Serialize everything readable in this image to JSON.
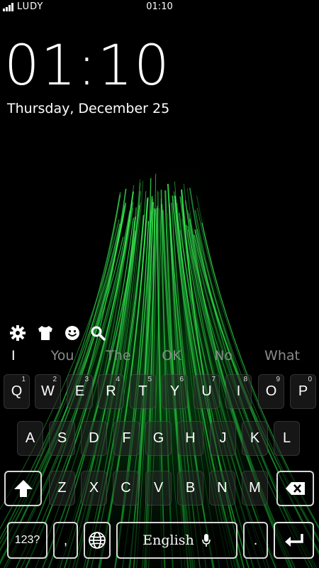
{
  "status_bar": {
    "carrier": "LUDY",
    "time": "01:10"
  },
  "lockscreen": {
    "clock": "01:10",
    "date": "Thursday, December 25"
  },
  "toolbar": {
    "icons": [
      "gear-icon",
      "shirt-icon",
      "smiley-icon",
      "search-icon"
    ]
  },
  "suggestions": [
    "I",
    "You",
    "The",
    "OK",
    "No",
    "What"
  ],
  "keyboard": {
    "row1": [
      {
        "k": "Q",
        "h": "1"
      },
      {
        "k": "W",
        "h": "2"
      },
      {
        "k": "E",
        "h": "3"
      },
      {
        "k": "R",
        "h": "4"
      },
      {
        "k": "T",
        "h": "5"
      },
      {
        "k": "Y",
        "h": "6"
      },
      {
        "k": "U",
        "h": "7"
      },
      {
        "k": "I",
        "h": "8"
      },
      {
        "k": "O",
        "h": "9"
      },
      {
        "k": "P",
        "h": "0"
      }
    ],
    "row2": [
      "A",
      "S",
      "D",
      "F",
      "G",
      "H",
      "J",
      "K",
      "L"
    ],
    "row3": [
      "Z",
      "X",
      "C",
      "V",
      "B",
      "N",
      "M"
    ],
    "numbers_label": "123?",
    "comma_label": ",",
    "space_label": "English",
    "period_label": "."
  },
  "colors": {
    "accent": "#2ecc40",
    "background": "#000000"
  }
}
